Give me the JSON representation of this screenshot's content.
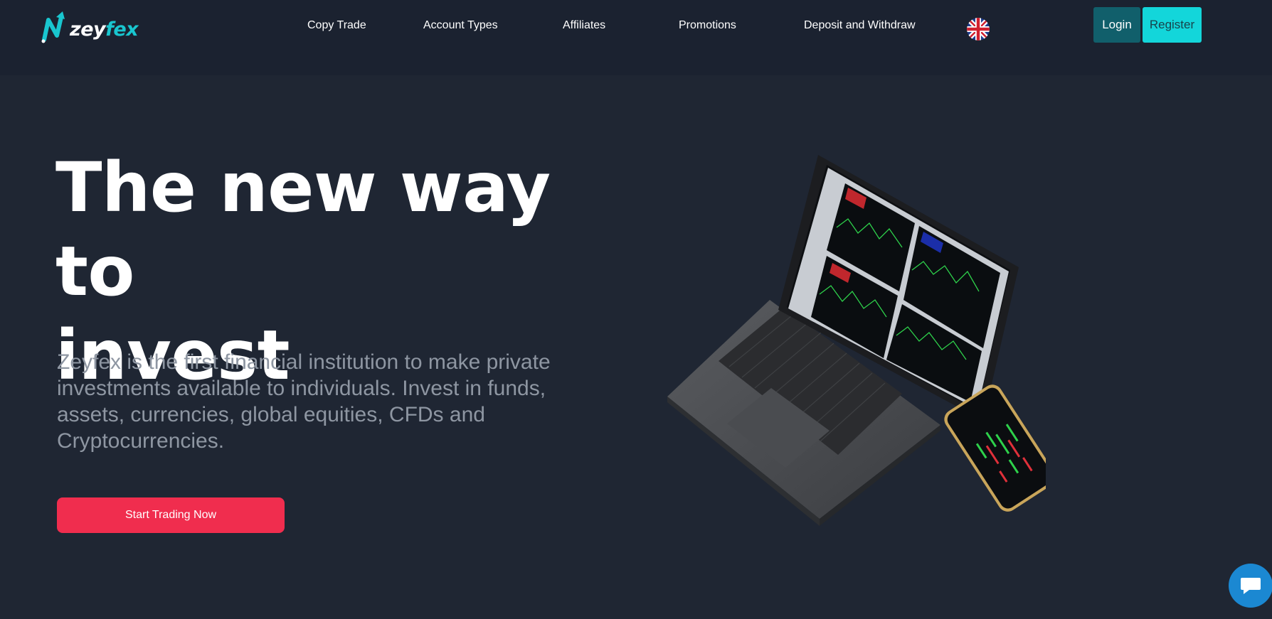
{
  "header": {
    "logo": {
      "text_main": "zey",
      "text_accent": "fex"
    },
    "nav": [
      {
        "label": "Copy Trade"
      },
      {
        "label": "Account Types"
      },
      {
        "label": "Affiliates"
      },
      {
        "label": "Promotions"
      },
      {
        "label": "Deposit and Withdraw"
      }
    ],
    "language_icon": "uk-flag-icon",
    "login_label": "Login",
    "register_label": "Register"
  },
  "hero": {
    "title_line1": "The new way to",
    "title_line2": "invest",
    "description": "Zeyfex is the first financial institution to make private investments available to individuals. Invest in funds, assets, currencies, global equities, CFDs and Cryptocurrencies.",
    "cta_label": "Start Trading Now",
    "illustration": "laptop-and-phone-trading-platform"
  },
  "chat": {
    "icon": "chat-bubble-icon"
  },
  "colors": {
    "background": "#1f2633",
    "header_bg": "#1b2230",
    "accent_cyan": "#13d6da",
    "login_bg": "#115f6b",
    "cta_red": "#f02d4e",
    "muted_text": "#8e96a2",
    "chat_blue": "#1b88d2"
  }
}
